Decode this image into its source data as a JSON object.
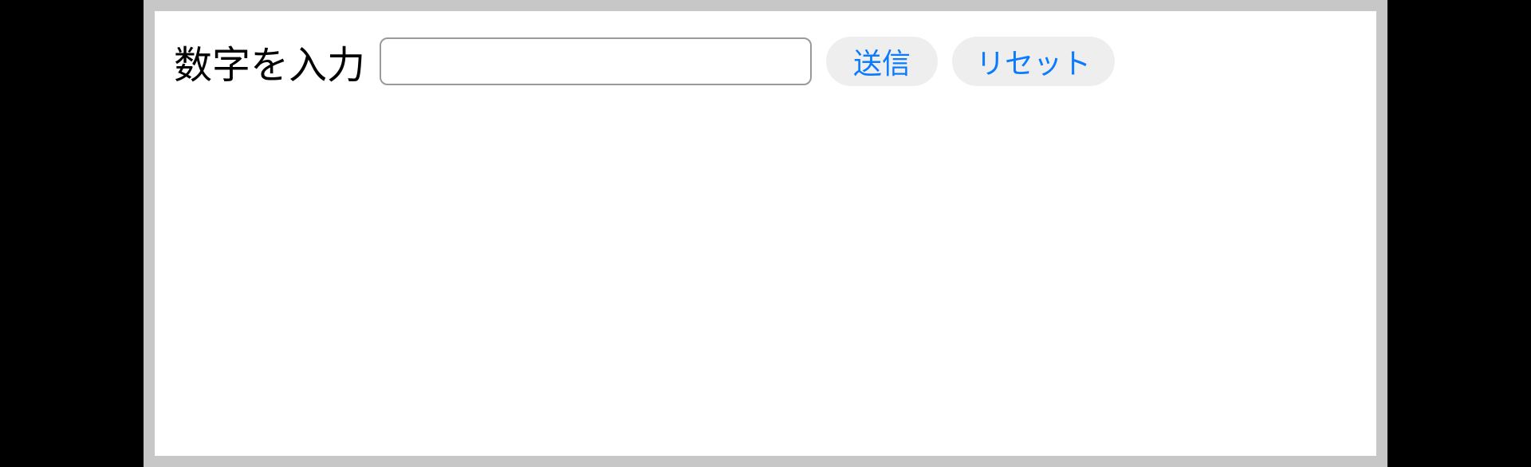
{
  "form": {
    "label": "数字を入力",
    "input_value": "",
    "input_placeholder": "",
    "submit_label": "送信",
    "reset_label": "リセット"
  }
}
